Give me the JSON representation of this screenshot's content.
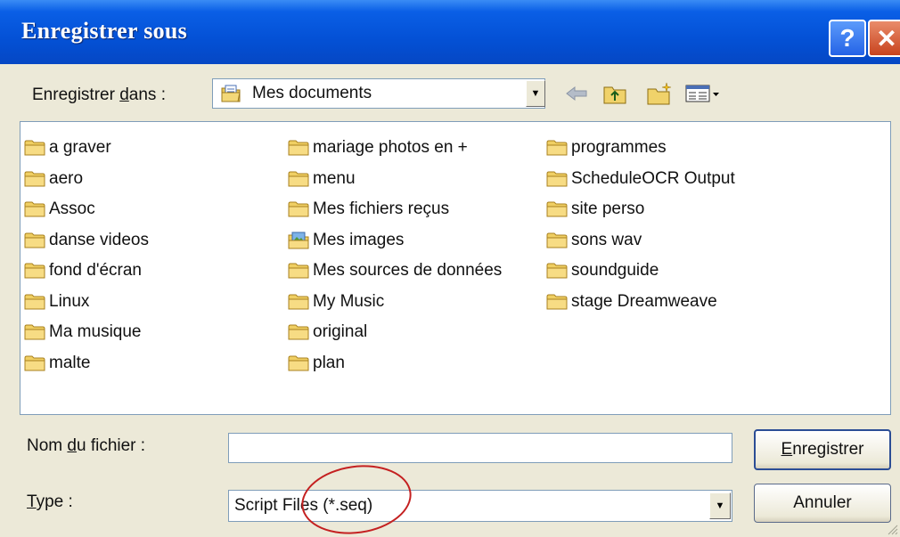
{
  "title": "Enregistrer sous",
  "titlebar_buttons": {
    "help": "?",
    "close": "✕"
  },
  "lookin": {
    "label_before": "Enregistrer ",
    "label_mnemonic": "d",
    "label_after": "ans :",
    "value": "Mes documents"
  },
  "columns": [
    [
      "a graver",
      "aero",
      "Assoc",
      "danse videos",
      "fond d'écran",
      "Linux",
      "Ma musique",
      "malte"
    ],
    [
      "mariage photos en +",
      "menu",
      "Mes fichiers reçus",
      "Mes images",
      "Mes sources de données",
      "My Music",
      "original",
      "plan"
    ],
    [
      "programmes",
      "ScheduleOCR Output",
      "site perso",
      "sons wav",
      "soundguide",
      "stage Dreamweave"
    ]
  ],
  "filename": {
    "label_before": "Nom ",
    "label_mnemonic": "d",
    "label_after": "u fichier :",
    "value": ""
  },
  "type": {
    "label_mnemonic": "T",
    "label_after": "ype :",
    "value": "Script Files (*.seq)"
  },
  "buttons": {
    "save_mnemonic": "E",
    "save_rest": "nregistrer",
    "cancel": "Annuler"
  },
  "colors": {
    "titlebar": "#0451d6",
    "dialog_bg": "#ece9d8",
    "annotation": "#c42020"
  },
  "icons": [
    "folder-icon",
    "documents-icon",
    "back-icon",
    "up-folder-icon",
    "new-folder-icon",
    "view-menu-icon",
    "images-folder-icon",
    "resize-grip-icon"
  ]
}
